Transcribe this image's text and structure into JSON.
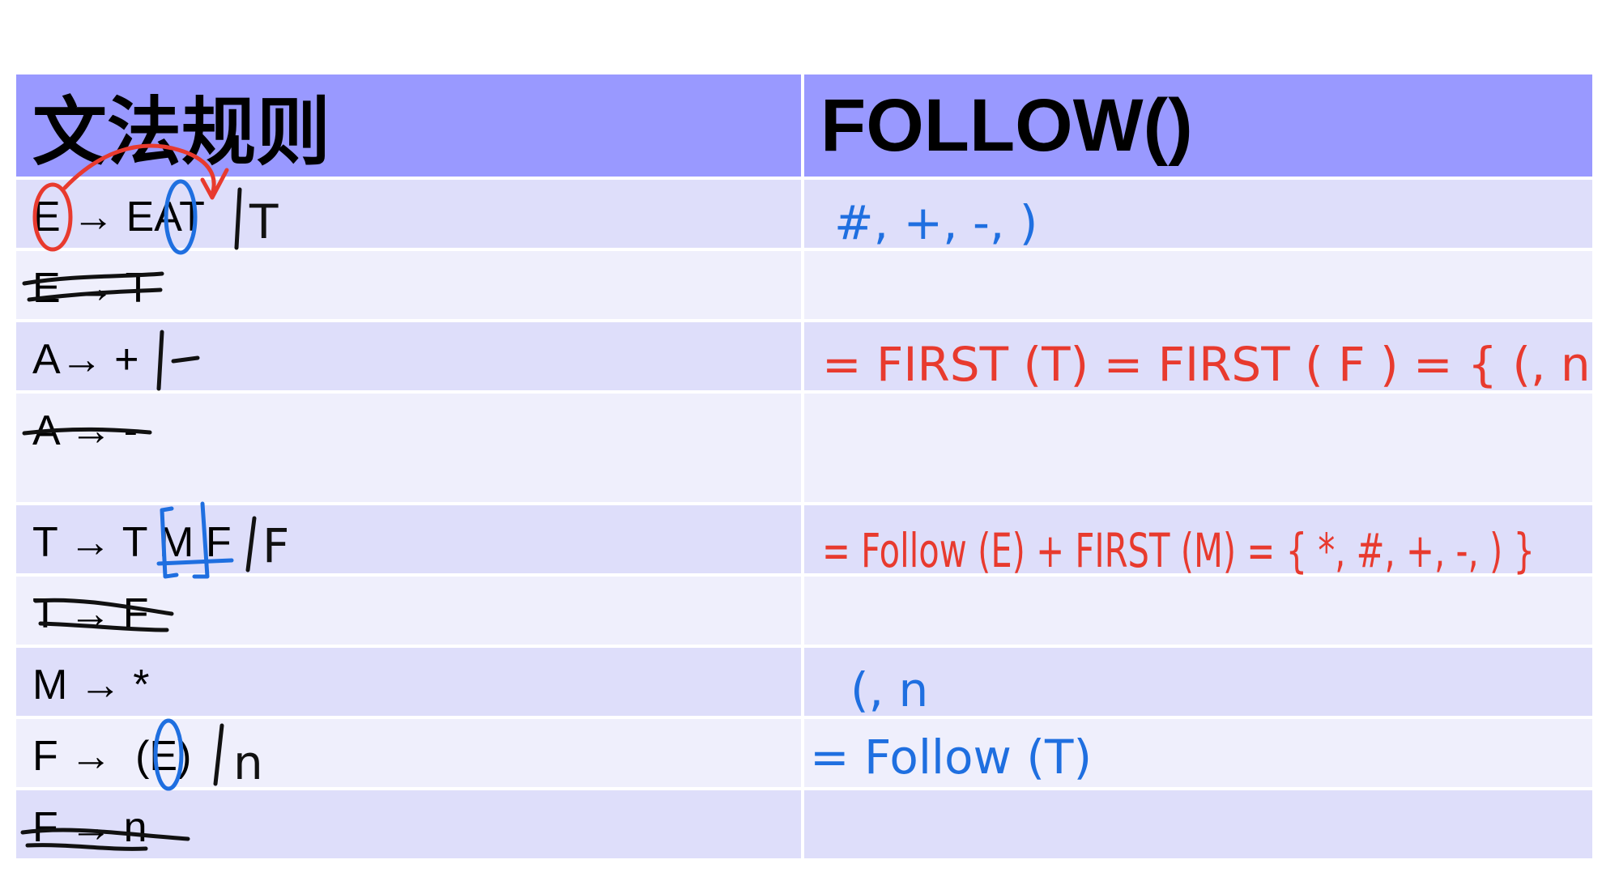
{
  "header": {
    "col1": "文法规则",
    "col2": "FOLLOW()"
  },
  "rows": [
    {
      "rule": "E → EAT",
      "struck": false
    },
    {
      "rule": "E → T",
      "struck": true
    },
    {
      "rule": "A→ +",
      "struck": false
    },
    {
      "rule": "A → -",
      "struck": true
    },
    {
      "rule": "T → T M F",
      "struck": false
    },
    {
      "rule": "T → F",
      "struck": true
    },
    {
      "rule": "M → *",
      "struck": false
    },
    {
      "rule": "F →  (E)",
      "struck": false
    },
    {
      "rule": "F → n",
      "struck": true
    }
  ],
  "handwriting": {
    "row0_addon": "| T",
    "row2_addon": "| -",
    "row4_addon": "| F",
    "row7_addon": "| n",
    "follow_E": "#, +, -, )",
    "follow_A": "= FIRST (T) = FIRST ( F ) = { (, n }",
    "follow_T": "= Follow (E) + FIRST (M) = { *, #, +, -, ) }",
    "follow_M": "(, n",
    "follow_F": "= Follow (T)"
  },
  "colors": {
    "header_bg": "#9999ff",
    "row_odd": "#dedefa",
    "row_even": "#efeffc",
    "ink_red": "#e83a2e",
    "ink_blue": "#1f6fe0",
    "ink_black": "#111111"
  }
}
